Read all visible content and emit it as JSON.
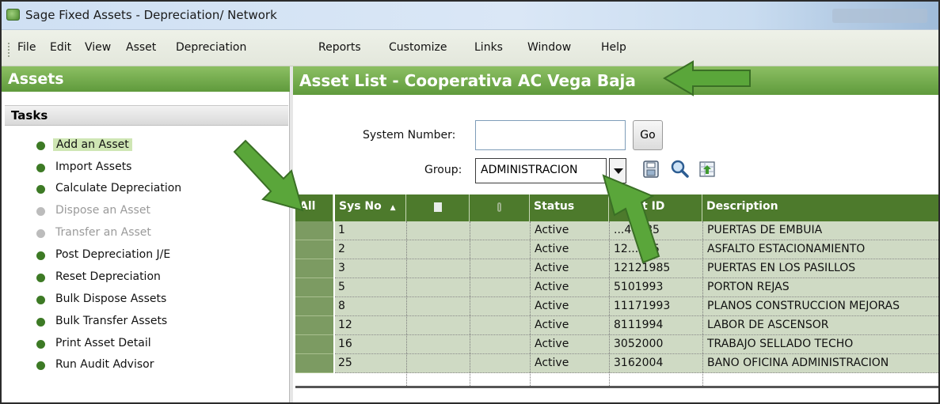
{
  "window": {
    "title": "Sage Fixed Assets - Depreciation/ Network"
  },
  "menu": [
    "File",
    "Edit",
    "View",
    "Asset",
    "Depreciation",
    "Reports",
    "Customize",
    "Links",
    "Window",
    "Help"
  ],
  "left_panel": {
    "header": "Assets",
    "tasks_title": "Tasks",
    "tasks": [
      {
        "label": "Add an Asset",
        "enabled": true,
        "selected": true
      },
      {
        "label": "Import Assets",
        "enabled": true
      },
      {
        "label": "Calculate Depreciation",
        "enabled": true
      },
      {
        "label": "Dispose an Asset",
        "enabled": false
      },
      {
        "label": "Transfer an Asset",
        "enabled": false
      },
      {
        "label": "Post Depreciation J/E",
        "enabled": true
      },
      {
        "label": "Reset Depreciation",
        "enabled": true
      },
      {
        "label": "Bulk Dispose Assets",
        "enabled": true
      },
      {
        "label": "Bulk Transfer Assets",
        "enabled": true
      },
      {
        "label": "Print Asset Detail",
        "enabled": true
      },
      {
        "label": "Run Audit Advisor",
        "enabled": true
      }
    ]
  },
  "main": {
    "header": "Asset List - Cooperativa AC Vega Baja",
    "system_number_label": "System Number:",
    "system_number_value": "",
    "go_label": "Go",
    "group_label": "Group:",
    "group_value": "ADMINISTRACION",
    "toolbar_icons": [
      "save-icon",
      "search-icon",
      "export-icon"
    ]
  },
  "grid": {
    "select_all_label": "All",
    "columns": [
      "Sys No",
      "",
      "",
      "Status",
      "Asset ID",
      "Description"
    ],
    "header_icons": [
      "sort-ascending-icon",
      "notes-icon",
      "attachment-icon"
    ],
    "rows": [
      {
        "sys_no": "1",
        "status": "Active",
        "asset_id": "...41985",
        "description": "PUERTAS DE EMBUIA"
      },
      {
        "sys_no": "2",
        "status": "Active",
        "asset_id": "12...985",
        "description": "ASFALTO ESTACIONAMIENTO"
      },
      {
        "sys_no": "3",
        "status": "Active",
        "asset_id": "12121985",
        "description": "PUERTAS EN LOS PASILLOS"
      },
      {
        "sys_no": "5",
        "status": "Active",
        "asset_id": "5101993",
        "description": "PORTON REJAS"
      },
      {
        "sys_no": "8",
        "status": "Active",
        "asset_id": "11171993",
        "description": "PLANOS CONSTRUCCION MEJORAS"
      },
      {
        "sys_no": "12",
        "status": "Active",
        "asset_id": "8111994",
        "description": "LABOR DE ASCENSOR"
      },
      {
        "sys_no": "16",
        "status": "Active",
        "asset_id": "3052000",
        "description": "TRABAJO SELLADO TECHO"
      },
      {
        "sys_no": "25",
        "status": "Active",
        "asset_id": "3162004",
        "description": "BANO OFICINA ADMINISTRACION"
      }
    ]
  },
  "colors": {
    "header_green": "#6aa444",
    "grid_header": "#4d7a2c",
    "row_fill": "#cfdac4",
    "annotation_arrow": "#5aa63a"
  }
}
